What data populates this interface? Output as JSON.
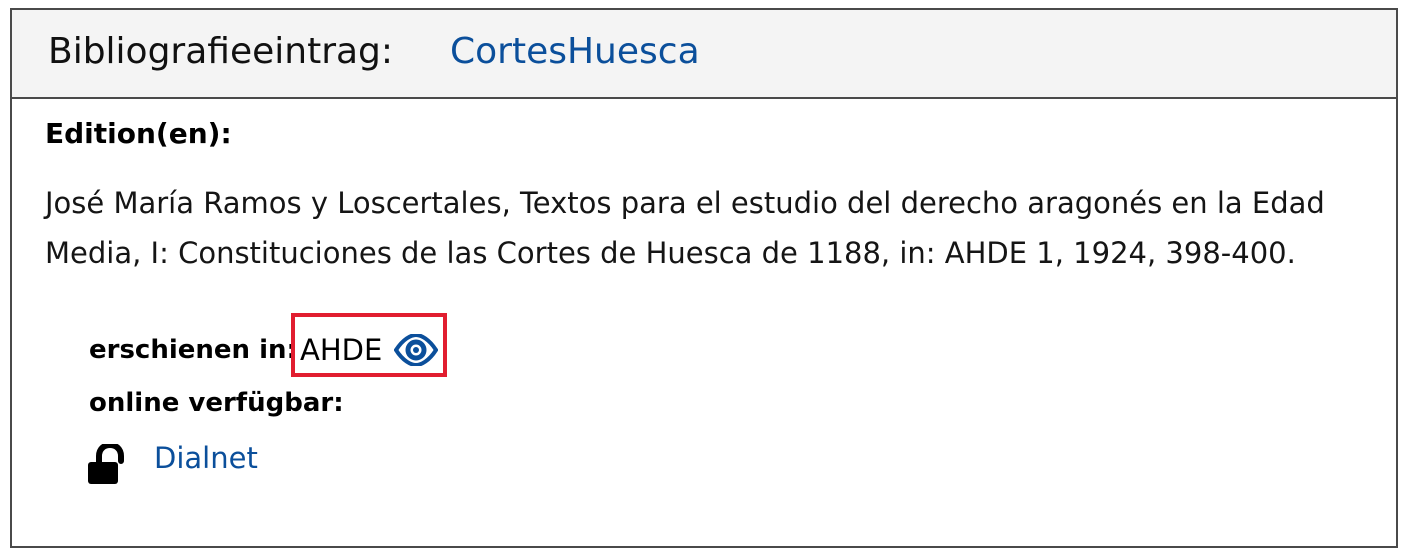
{
  "header": {
    "label": "Bibliografieeintrag:",
    "entry_link": "CortesHuesca"
  },
  "edition": {
    "title": "Edition(en):",
    "citation": "José María Ramos y Loscertales, Textos para el estudio del derecho aragonés en la Edad Media, I: Constituciones de las Cortes de Huesca de 1188, in: AHDE 1, 1924, 398-400.",
    "published_label": "erschienen in:",
    "published_value": "AHDE",
    "online_label": "online verfügbar:",
    "online_resource": "Dialnet"
  },
  "icons": {
    "view": "eye-icon",
    "access": "unlock-icon"
  },
  "colors": {
    "link": "#0b4f9b",
    "highlight": "#e11d2f",
    "header_background": "#f4f4f4"
  }
}
